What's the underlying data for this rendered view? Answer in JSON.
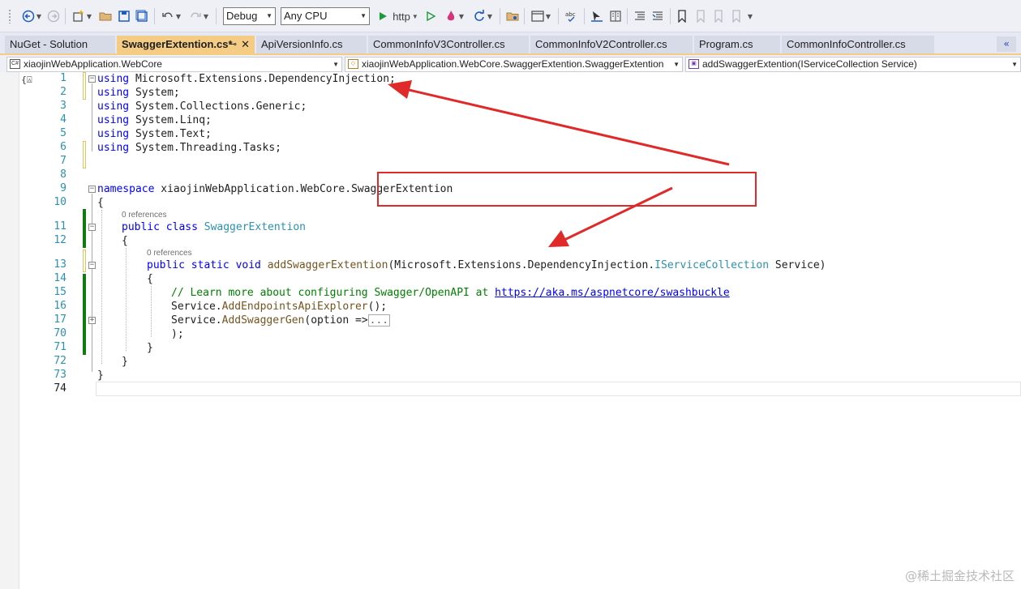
{
  "toolbar": {
    "config_value": "Debug",
    "platform_value": "Any CPU",
    "run_label": "http"
  },
  "tabs": [
    {
      "label": "NuGet - Solution",
      "active": false
    },
    {
      "label": "SwaggerExtention.cs*",
      "active": true
    },
    {
      "label": "ApiVersionInfo.cs",
      "active": false
    },
    {
      "label": "CommonInfoV3Controller.cs",
      "active": false
    },
    {
      "label": "CommonInfoV2Controller.cs",
      "active": false
    },
    {
      "label": "Program.cs",
      "active": false
    },
    {
      "label": "CommonInfoController.cs",
      "active": false
    }
  ],
  "navbar": {
    "project": "xiaojinWebApplication.WebCore",
    "type": "xiaojinWebApplication.WebCore.SwaggerExtention.SwaggerExtention",
    "member": "addSwaggerExtention(IServiceCollection Service)"
  },
  "editor": {
    "line_numbers": [
      "1",
      "2",
      "3",
      "4",
      "5",
      "6",
      "7",
      "8",
      "9",
      "10",
      "11",
      "12",
      "13",
      "14",
      "15",
      "16",
      "17",
      "70",
      "71",
      "72",
      "73",
      "74"
    ],
    "lines": {
      "l1_kw": "using",
      "l1_ns": " Microsoft.Extensions.DependencyInjection;",
      "l2_kw": "using",
      "l2_ns": " System;",
      "l3_kw": "using",
      "l3_ns": " System.Collections.Generic;",
      "l4_kw": "using",
      "l4_ns": " System.Linq;",
      "l5_kw": "using",
      "l5_ns": " System.Text;",
      "l6_kw": "using",
      "l6_ns": " System.Threading.Tasks;",
      "l9_kw": "namespace",
      "l9_ns": " xiaojinWebApplication.WebCore.SwaggerExtention",
      "l10": "{",
      "l11_mod": "public class",
      "l11_type": " SwaggerExtention",
      "l12": "{",
      "l13_mod": "public static void",
      "l13_method": " addSwaggerExtention",
      "l13_param_ns": "(Microsoft.Extensions.DependencyInjection.",
      "l13_param_type": "IServiceCollection",
      "l13_param_name": " Service)",
      "l14": "{",
      "l15_comment": "// Learn more about configuring Swagger/OpenAPI at ",
      "l15_link": "https://aka.ms/aspnetcore/swashbuckle",
      "l16_obj": "Service.",
      "l16_method": "AddEndpointsApiExplorer",
      "l16_end": "();",
      "l17_obj": "Service.",
      "l17_method": "AddSwaggerGen",
      "l17_mid": "(option =>",
      "l17_collapsed": "...",
      "l70": ");",
      "l71": "}",
      "l72": "}",
      "l73": "}"
    },
    "references_class": "0 references",
    "references_method": "0 references"
  },
  "watermark": "@稀土掘金技术社区",
  "colors": {
    "keyword": "#0000ff",
    "type": "#2b91af",
    "method": "#74531f",
    "comment": "#008000",
    "annotation": "#e02a2a",
    "active_tab": "#f5cc84"
  }
}
